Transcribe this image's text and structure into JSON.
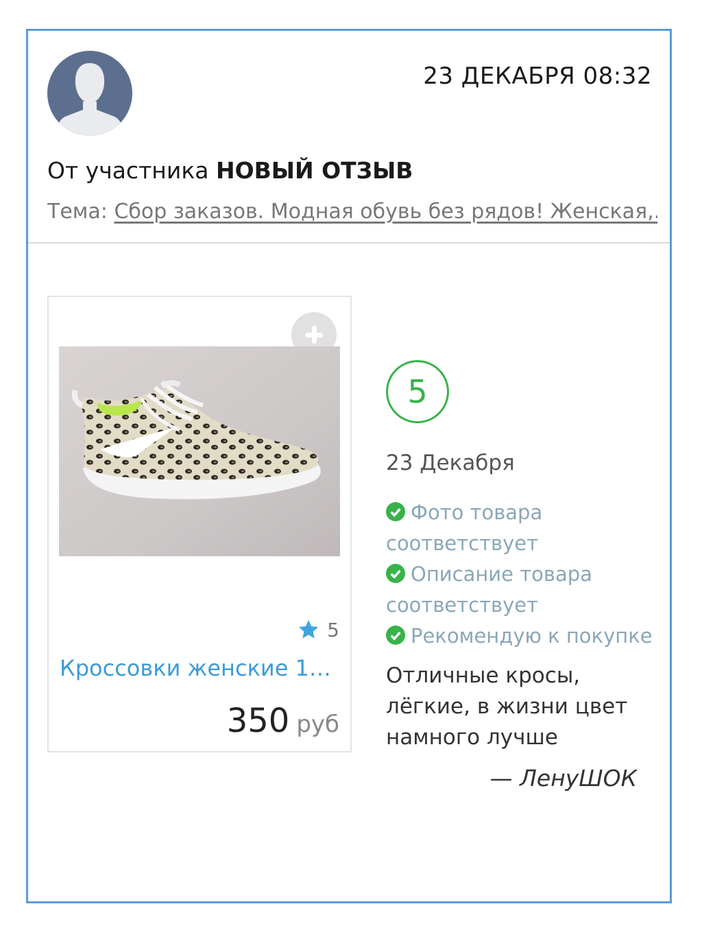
{
  "header": {
    "datetime": "23 ДЕКАБРЯ 08:32",
    "from_prefix": "От участника",
    "from_title": "НОВЫЙ ОТЗЫВ",
    "theme_label": "Тема:",
    "theme_link": "Сбор заказов. Модная обувь без рядов! Женская,...",
    "avatar_icon": "user-silhouette-icon"
  },
  "product": {
    "add_icon": "plus-icon",
    "rating_icon": "star-icon",
    "rating": "5",
    "title": "Кроссовки женские 1-...",
    "price": "350",
    "currency": "руб"
  },
  "review": {
    "score": "5",
    "date": "23 Декабря",
    "checks": [
      "Фото товара соответствует",
      "Описание товара соответствует",
      "Рекомендую к покупке"
    ],
    "text": "Отличные кросы, лёгкие, в жизни цвет намного лучше",
    "author": "— ЛенуШОК"
  },
  "colors": {
    "border": "#5b9bd5",
    "link": "#3d9bd6",
    "green": "#37b34a",
    "check_text": "#8aa7b8"
  }
}
